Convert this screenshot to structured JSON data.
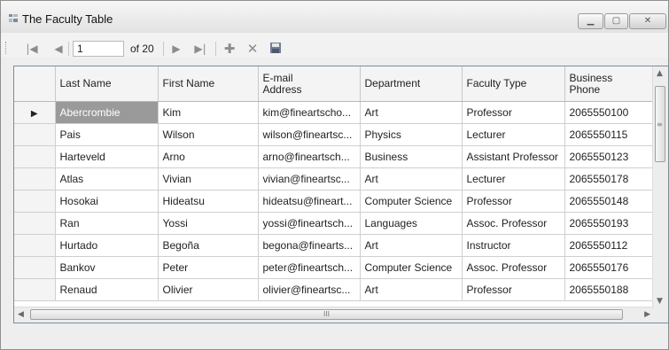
{
  "window": {
    "title": "The Faculty Table"
  },
  "navigator": {
    "position": "1",
    "count_label": "of 20"
  },
  "grid": {
    "columns": [
      "Last Name",
      "First Name",
      "E-mail\nAddress",
      "Department",
      "Faculty Type",
      "Business\nPhone"
    ],
    "rows": [
      [
        "Abercrombie",
        "Kim",
        "kim@fineartscho...",
        "Art",
        "Professor",
        "2065550100"
      ],
      [
        "Pais",
        "Wilson",
        "wilson@fineartsc...",
        "Physics",
        "Lecturer",
        "2065550115"
      ],
      [
        "Harteveld",
        "Arno",
        "arno@fineartsch...",
        "Business",
        "Assistant Professor",
        "2065550123"
      ],
      [
        "Atlas",
        "Vivian",
        "vivian@fineartsc...",
        "Art",
        "Lecturer",
        "2065550178"
      ],
      [
        "Hosokai",
        "Hideatsu",
        "hideatsu@fineart...",
        "Computer Science",
        "Professor",
        "2065550148"
      ],
      [
        "Ran",
        "Yossi",
        "yossi@fineartsch...",
        "Languages",
        "Assoc. Professor",
        "2065550193"
      ],
      [
        "Hurtado",
        "Begoña",
        "begona@finearts...",
        "Art",
        "Instructor",
        "2065550112"
      ],
      [
        "Bankov",
        "Peter",
        "peter@fineartsch...",
        "Computer Science",
        "Assoc. Professor",
        "2065550176"
      ],
      [
        "Renaud",
        "Olivier",
        "olivier@fineartsc...",
        "Art",
        "Professor",
        "2065550188"
      ]
    ],
    "current_row_marker": "▶",
    "scroll_grip": "III"
  }
}
